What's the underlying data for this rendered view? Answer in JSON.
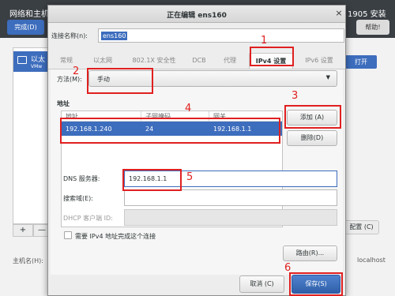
{
  "background": {
    "title": "网络和主机名",
    "done_label": "完成(D)",
    "version": "1905 安装",
    "help_label": "帮助!",
    "list_item_title": "以太",
    "list_item_sub": "VMw",
    "add_label": "+",
    "minus_label": "—",
    "toggle_label": "打开",
    "config_label": "配置 (C)",
    "hostname_label": "主机名(H):",
    "hostname_value": "localhost"
  },
  "dialog": {
    "title": "正在编辑 ens160",
    "close_label": "×",
    "connection_name_label": "连接名称(n):",
    "connection_name_value": "ens160",
    "tabs": [
      {
        "label": "常规"
      },
      {
        "label": "以太网"
      },
      {
        "label": "802.1X 安全性"
      },
      {
        "label": "DCB"
      },
      {
        "label": "代理"
      },
      {
        "label": "IPv4 设置"
      },
      {
        "label": "IPv6 设置"
      }
    ],
    "active_tab": "IPv4 设置",
    "method_label": "方法(M):",
    "method_value": "手动",
    "address_heading": "地址",
    "address_columns": [
      "地址",
      "子网掩码",
      "网关"
    ],
    "address_rows": [
      {
        "address": "192.168.1.240",
        "netmask": "24",
        "gateway": "192.168.1.1"
      }
    ],
    "add_button": "添加 (A)",
    "delete_button": "删除(D)",
    "dns_label": "DNS 服务器:",
    "dns_value": "192.168.1.1",
    "search_domain_label": "搜索域(E):",
    "search_domain_value": "",
    "dhcp_client_id_label": "DHCP 客户端 ID:",
    "dhcp_client_id_value": "",
    "require_ipv4_label": "需要 IPv4 地址完成这个连接",
    "routes_button": "路由(R)...",
    "cancel_button": "取消 (C)",
    "save_button": "保存(S)"
  },
  "annotations": {
    "step1": "1",
    "step2": "2",
    "step3": "3",
    "step4": "4",
    "step5": "5",
    "step6": "6",
    "color": "#e02020"
  }
}
